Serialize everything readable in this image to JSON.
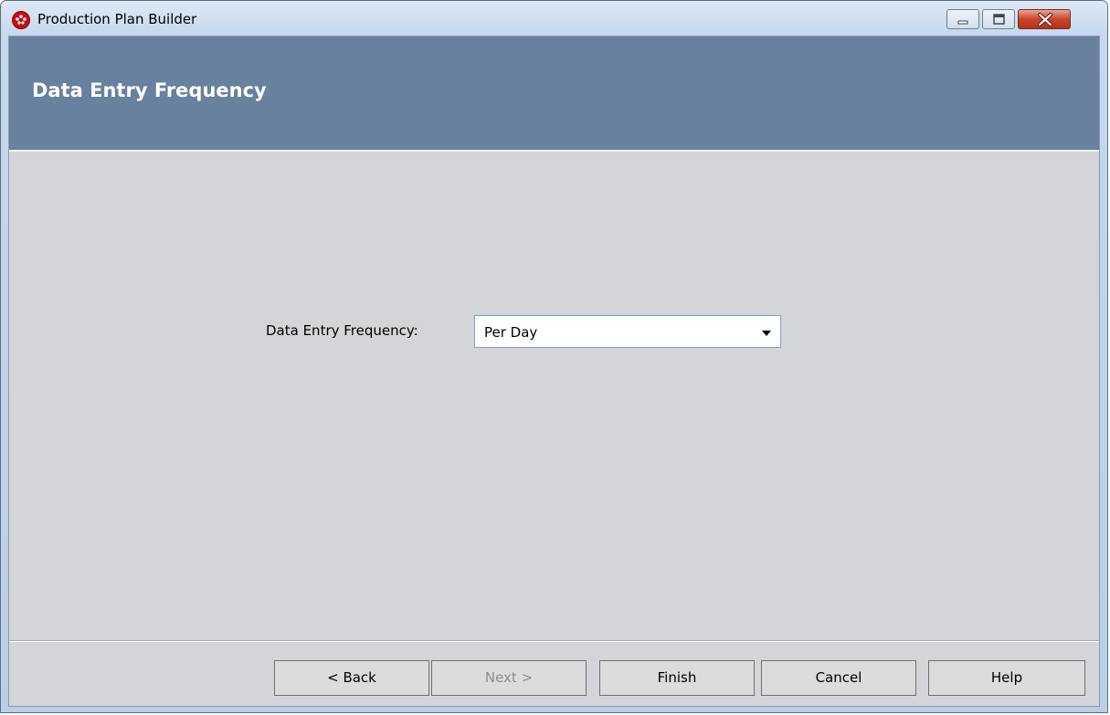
{
  "window": {
    "title": "Production Plan Builder",
    "controls": {
      "minimize": "minimize-icon",
      "maximize": "maximize-icon",
      "close": "close-icon"
    }
  },
  "header": {
    "title": "Data Entry Frequency",
    "background": "#67819f"
  },
  "form": {
    "frequency_label": "Data Entry Frequency:",
    "frequency_value": "Per Day"
  },
  "footer": {
    "back_label": "< Back",
    "next_label": "Next >",
    "finish_label": "Finish",
    "cancel_label": "Cancel",
    "help_label": "Help"
  }
}
